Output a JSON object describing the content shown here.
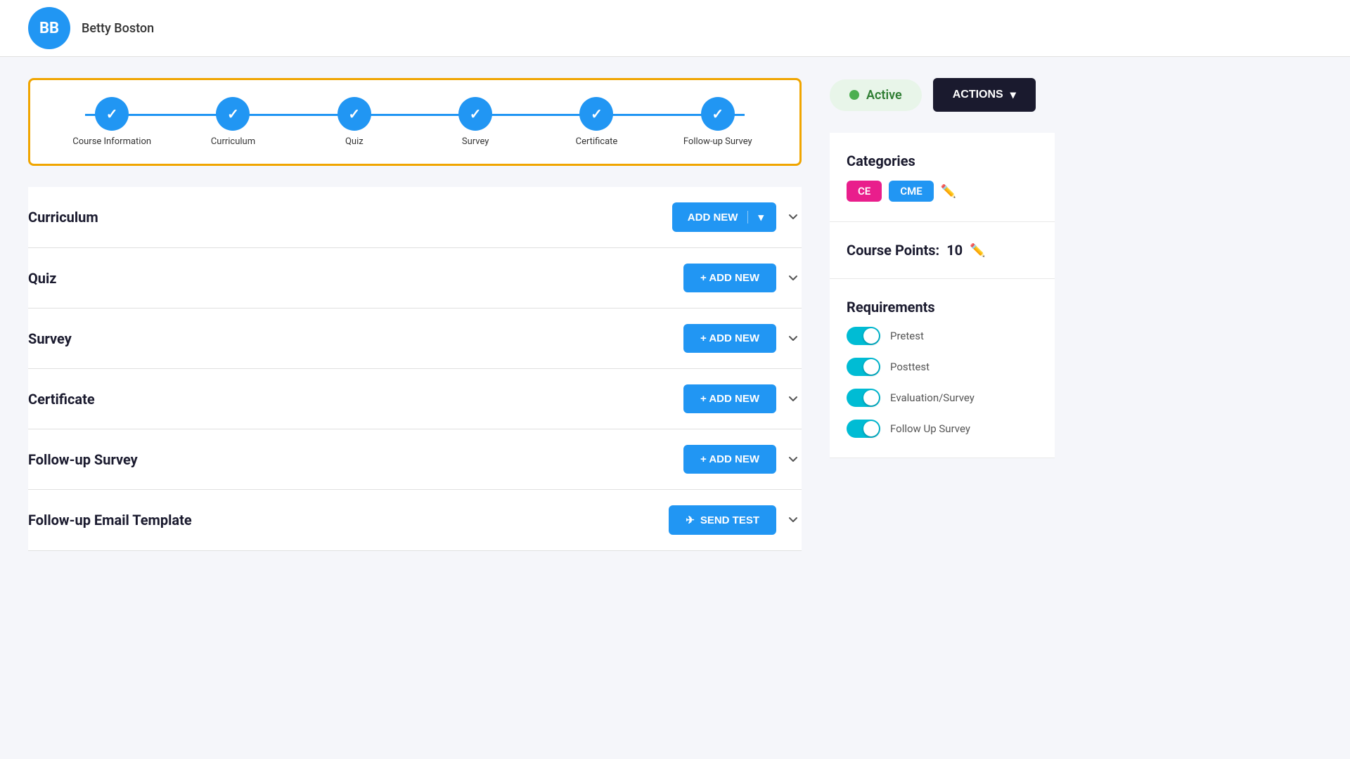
{
  "header": {
    "user_name": "Betty Boston",
    "avatar_initials": "BB"
  },
  "stepper": {
    "steps": [
      {
        "label": "Course Information",
        "completed": true
      },
      {
        "label": "Curriculum",
        "completed": true
      },
      {
        "label": "Quiz",
        "completed": true
      },
      {
        "label": "Survey",
        "completed": true
      },
      {
        "label": "Certificate",
        "completed": true
      },
      {
        "label": "Follow-up Survey",
        "completed": true
      }
    ]
  },
  "sections": [
    {
      "id": "curriculum",
      "title": "Curriculum",
      "button_type": "dropdown",
      "button_label": "ADD NEW"
    },
    {
      "id": "quiz",
      "title": "Quiz",
      "button_type": "add",
      "button_label": "+ ADD NEW"
    },
    {
      "id": "survey",
      "title": "Survey",
      "button_type": "add",
      "button_label": "+ ADD NEW"
    },
    {
      "id": "certificate",
      "title": "Certificate",
      "button_type": "add",
      "button_label": "+ ADD NEW"
    },
    {
      "id": "followup-survey",
      "title": "Follow-up Survey",
      "button_type": "add",
      "button_label": "+ ADD NEW"
    },
    {
      "id": "followup-email",
      "title": "Follow-up Email Template",
      "button_type": "send",
      "button_label": "SEND TEST"
    }
  ],
  "status": {
    "label": "Active",
    "color": "#4CAF50",
    "bg_color": "#e8f5e9",
    "text_color": "#2e7d32"
  },
  "actions_button": "ACTIONS",
  "sidebar": {
    "categories_title": "Categories",
    "categories": [
      {
        "label": "CE",
        "color": "#e91e8c"
      },
      {
        "label": "CME",
        "color": "#2196F3"
      }
    ],
    "course_points_label": "Course Points:",
    "course_points_value": "10",
    "requirements_title": "Requirements",
    "requirements": [
      {
        "label": "Pretest",
        "enabled": true
      },
      {
        "label": "Posttest",
        "enabled": true
      },
      {
        "label": "Evaluation/Survey",
        "enabled": true
      },
      {
        "label": "Follow Up Survey",
        "enabled": true
      }
    ]
  }
}
